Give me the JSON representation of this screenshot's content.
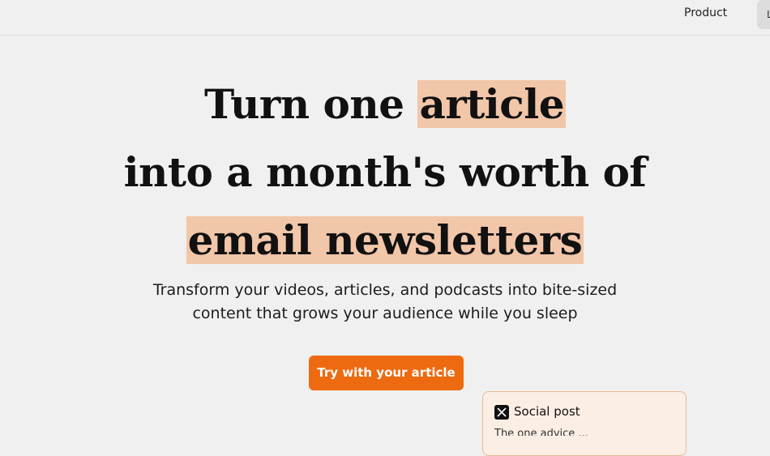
{
  "nav": {
    "product_label": "Product",
    "login_label": "L"
  },
  "hero": {
    "line1_text": "Turn one ",
    "line1_highlight": "article",
    "line2_text": "into a month's worth of",
    "line3_highlight": "email newsletters",
    "subtitle": "Transform your videos, articles, and podcasts into bite-sized content that grows your audience while you sleep",
    "cta_label": "Try with your article"
  },
  "card": {
    "title": "Social post",
    "icon": "x-icon",
    "preview": "The one advice ..."
  },
  "colors": {
    "background": "#f0f0f0",
    "highlight": "#f2c6a9",
    "accent": "#ee6a10",
    "card_bg": "#fbeee4",
    "card_border": "#e7b990"
  }
}
